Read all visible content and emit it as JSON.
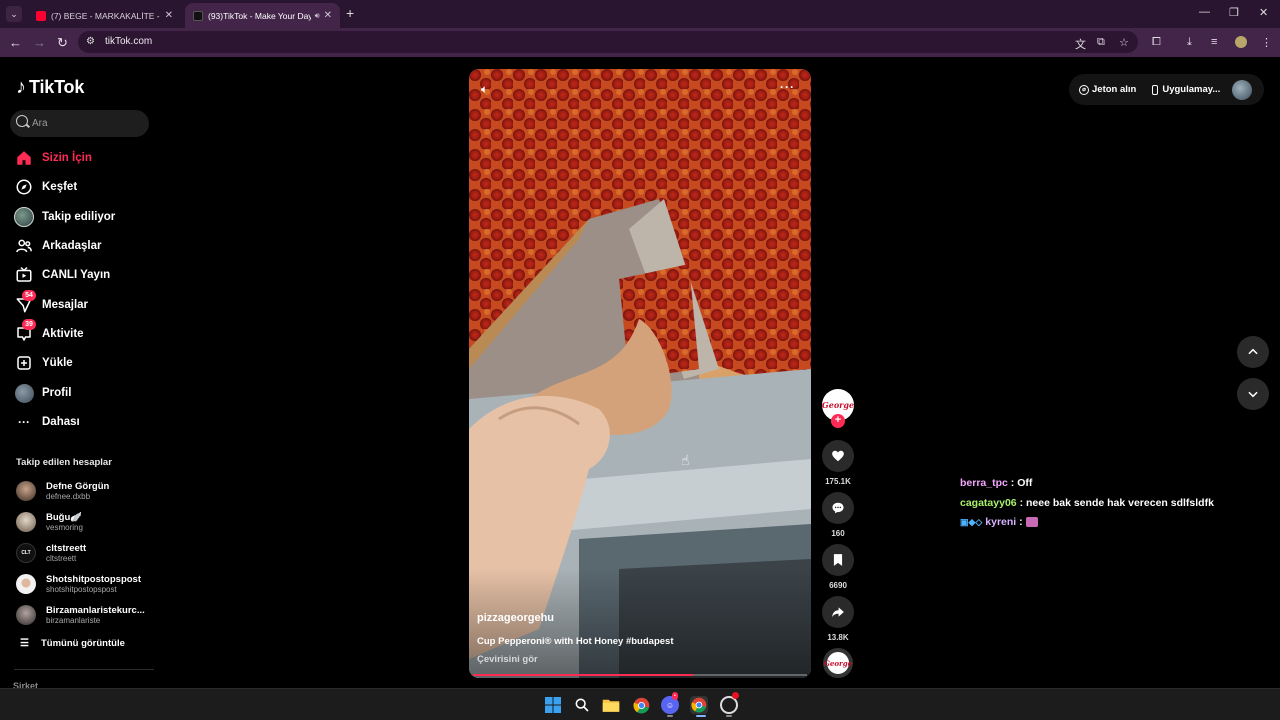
{
  "browser": {
    "tabs": [
      {
        "title": "(7) BEGE - MARKAKALİTE - YouTube",
        "active": false,
        "favicon_color": "#ff0033"
      },
      {
        "title": "(93)TikTok - Make Your Day",
        "active": true,
        "favicon_color": "#000000"
      }
    ],
    "url": "tikTok.com"
  },
  "sidebar": {
    "logo_text": "TikTok",
    "search_placeholder": "Ara",
    "nav": [
      {
        "label": "Sizin İçin",
        "icon": "home-icon",
        "active": true
      },
      {
        "label": "Keşfet",
        "icon": "compass-icon"
      },
      {
        "label": "Takip ediliyor",
        "icon": "following-avatar-icon"
      },
      {
        "label": "Arkadaşlar",
        "icon": "friends-icon"
      },
      {
        "label": "CANLI Yayın",
        "icon": "live-icon"
      },
      {
        "label": "Mesajlar",
        "icon": "messages-icon",
        "badge": "54"
      },
      {
        "label": "Aktivite",
        "icon": "activity-icon",
        "badge": "39"
      },
      {
        "label": "Yükle",
        "icon": "upload-icon"
      },
      {
        "label": "Profil",
        "icon": "profile-avatar-icon"
      },
      {
        "label": "Dahası",
        "icon": "more-icon"
      }
    ],
    "followed_title": "Takip edilen hesaplar",
    "followed": [
      {
        "name": "Defne Görgün",
        "handle": "defnee.dxbb"
      },
      {
        "name": "Buğu🪽",
        "handle": "vesmoring"
      },
      {
        "name": "cltstreett",
        "handle": "cltstreett",
        "avatar_text": "CLT"
      },
      {
        "name": "Shotshitpostopspost",
        "handle": "shotshitpostopspost"
      },
      {
        "name": "Birzamanlaristekurc...",
        "handle": "birzamanlariste"
      }
    ],
    "see_all": "Tümünü görüntüle",
    "footer_section": "Şirket"
  },
  "video": {
    "username": "pizzageorgehu",
    "caption": "Cup Pepperoni® with Hot Honey #budapest",
    "translate": "Çevirisini gör",
    "progress": 0.66
  },
  "actions": {
    "creator_logo": "George",
    "likes": "175.1K",
    "comments": "160",
    "saves": "6690",
    "shares": "13.8K"
  },
  "top_right": {
    "coins": "Jeton alın",
    "app": "Uygulamay..."
  },
  "chat": [
    {
      "user": "berra_tpc",
      "message": "Off"
    },
    {
      "user": "cagatayy06",
      "message": "neee bak sende hak verecen sdlfsldfk"
    },
    {
      "user": "kyreni",
      "message": ""
    }
  ],
  "colors": {
    "accent": "#fe2c55",
    "browser_frame": "#43254a",
    "tab_strip": "#2a1530"
  }
}
